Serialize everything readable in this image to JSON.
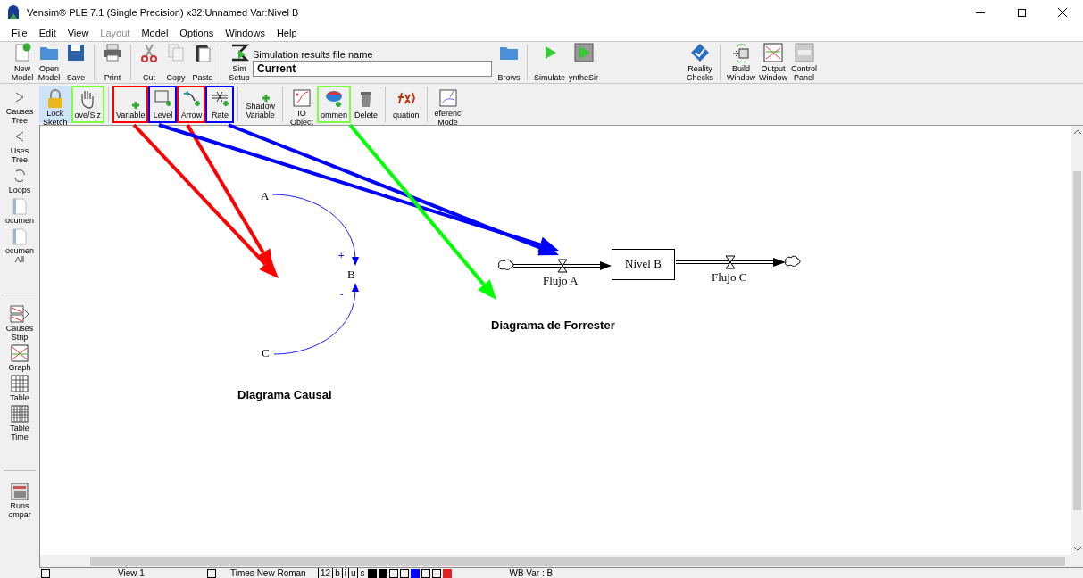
{
  "window": {
    "title": "Vensim® PLE 7.1 (Single Precision) x32:Unnamed Var:Nivel B"
  },
  "menu": [
    {
      "label": "File",
      "disabled": false
    },
    {
      "label": "Edit",
      "disabled": false
    },
    {
      "label": "View",
      "disabled": false
    },
    {
      "label": "Layout",
      "disabled": true
    },
    {
      "label": "Model",
      "disabled": false
    },
    {
      "label": "Options",
      "disabled": false
    },
    {
      "label": "Windows",
      "disabled": false
    },
    {
      "label": "Help",
      "disabled": false
    }
  ],
  "toolbar": [
    {
      "kind": "tool",
      "lines": [
        "New",
        "Model"
      ]
    },
    {
      "kind": "tool",
      "lines": [
        "Open",
        "Model"
      ]
    },
    {
      "kind": "tool",
      "lines": [
        "Save"
      ]
    },
    {
      "kind": "separator"
    },
    {
      "kind": "tool",
      "lines": [
        "Print"
      ]
    },
    {
      "kind": "separator"
    },
    {
      "kind": "tool",
      "lines": [
        "Cut"
      ]
    },
    {
      "kind": "tool",
      "lines": [
        "Copy"
      ]
    },
    {
      "kind": "tool",
      "lines": [
        "Paste"
      ]
    },
    {
      "kind": "separator"
    },
    {
      "kind": "tool",
      "lines": [
        "Sim",
        "Setup"
      ]
    },
    {
      "kind": "field",
      "label": "Simulation results file name",
      "value": "Current"
    },
    {
      "kind": "tool",
      "lines": [
        "Brows"
      ]
    },
    {
      "kind": "separator"
    },
    {
      "kind": "tool",
      "lines": [
        "Simulate"
      ]
    },
    {
      "kind": "tool",
      "lines": [
        "yntheSir"
      ]
    },
    {
      "kind": "spacer"
    },
    {
      "kind": "tool",
      "lines": [
        "Reality",
        "Checks"
      ]
    },
    {
      "kind": "separator"
    },
    {
      "kind": "tool",
      "lines": [
        "Build",
        "Window"
      ]
    },
    {
      "kind": "tool",
      "lines": [
        "Output",
        "Window"
      ]
    },
    {
      "kind": "tool",
      "lines": [
        "Control",
        "Panel"
      ]
    }
  ],
  "sketch_tools": [
    {
      "kind": "tool",
      "lines": [
        "Lock",
        "Sketch"
      ],
      "selected": true
    },
    {
      "kind": "tool",
      "lines": [
        "ove/Siz"
      ],
      "selected": false,
      "color": "#80ff40"
    },
    {
      "kind": "separator"
    },
    {
      "kind": "tool",
      "lines": [
        "Variable"
      ],
      "selected": false,
      "color": "#ff0000"
    },
    {
      "kind": "tool",
      "lines": [
        "Level"
      ],
      "selected": false,
      "color": "#0000ff"
    },
    {
      "kind": "tool",
      "lines": [
        "Arrow"
      ],
      "selected": false,
      "color": "#ff0000"
    },
    {
      "kind": "tool",
      "lines": [
        "Rate"
      ],
      "selected": false,
      "color": "#0000ff"
    },
    {
      "kind": "separator"
    },
    {
      "kind": "tool",
      "lines": [
        "Shadow",
        "Variable"
      ],
      "selected": false
    },
    {
      "kind": "separator"
    },
    {
      "kind": "tool",
      "lines": [
        "IO",
        "Object"
      ],
      "selected": false
    },
    {
      "kind": "tool",
      "lines": [
        "ommen"
      ],
      "selected": false,
      "color": "#80ff40"
    },
    {
      "kind": "tool",
      "lines": [
        "Delete"
      ],
      "selected": false
    },
    {
      "kind": "separator"
    },
    {
      "kind": "tool",
      "lines": [
        "quation"
      ],
      "selected": false
    },
    {
      "kind": "separator"
    },
    {
      "kind": "tool",
      "lines": [
        "eferenc",
        "Mode"
      ],
      "selected": false
    }
  ],
  "sidebar": [
    {
      "kind": "tool",
      "lines": [
        "Causes",
        "Tree"
      ]
    },
    {
      "kind": "tool",
      "lines": [
        "Uses",
        "Tree"
      ]
    },
    {
      "kind": "tool",
      "lines": [
        "Loops"
      ]
    },
    {
      "kind": "tool",
      "lines": [
        "ocumen"
      ]
    },
    {
      "kind": "tool",
      "lines": [
        "ocumen",
        "All"
      ]
    },
    {
      "kind": "separator"
    },
    {
      "kind": "tool",
      "lines": [
        "Causes",
        "Strip"
      ]
    },
    {
      "kind": "tool",
      "lines": [
        "Graph"
      ]
    },
    {
      "kind": "tool",
      "lines": [
        "Table"
      ]
    },
    {
      "kind": "tool",
      "lines": [
        "Table",
        "Time"
      ]
    },
    {
      "kind": "separator"
    },
    {
      "kind": "tool",
      "lines": [
        "Runs",
        "ompar"
      ]
    }
  ],
  "causal_diagram": {
    "variables": [
      "A",
      "B",
      "C"
    ],
    "polarities": [
      "+",
      "-"
    ],
    "caption": "Diagrama Causal"
  },
  "forrester_diagram": {
    "level": "Nivel B",
    "flows": [
      "Flujo A",
      "Flujo C"
    ],
    "caption": "Diagrama de Forrester"
  },
  "annotation_arrows": [
    {
      "color": "#ff0000"
    },
    {
      "color": "#ff0000"
    },
    {
      "color": "#0000ff"
    },
    {
      "color": "#0000ff"
    },
    {
      "color": "#00ff00"
    }
  ],
  "status_bar": {
    "view": "View 1",
    "font": "Times New Roman",
    "size": "12",
    "styles": [
      "b",
      "i",
      "u",
      "s"
    ],
    "selection": "WB Var : B"
  }
}
